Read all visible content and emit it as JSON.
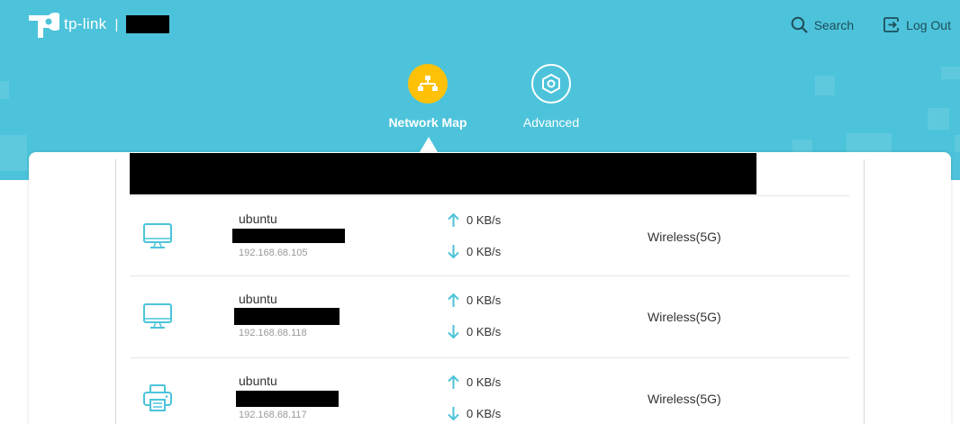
{
  "brand": {
    "logo_text": "tp-link",
    "separator": "|"
  },
  "header": {
    "search_label": "Search",
    "logout_label": "Log Out"
  },
  "nav": {
    "tabs": [
      {
        "label": "Network Map",
        "icon": "network-map-icon",
        "active": true
      },
      {
        "label": "Advanced",
        "icon": "gear-icon",
        "active": false
      }
    ]
  },
  "colors": {
    "header_bg": "#4cc3da",
    "active_tab": "#ffc107",
    "icon_teal": "#4cc3da"
  },
  "devices": [
    {
      "name": "ubuntu",
      "ip": "192.168.68.105",
      "upload": "0 KB/s",
      "download": "0 KB/s",
      "connection": "Wireless(5G)",
      "icon": "monitor-icon"
    },
    {
      "name": "ubuntu",
      "ip": "192.168.68.118",
      "upload": "0 KB/s",
      "download": "0 KB/s",
      "connection": "Wireless(5G)",
      "icon": "monitor-icon"
    },
    {
      "name": "ubuntu",
      "ip": "192.168.68.117",
      "upload": "0 KB/s",
      "download": "0 KB/s",
      "connection": "Wireless(5G)",
      "icon": "printer-icon"
    }
  ]
}
